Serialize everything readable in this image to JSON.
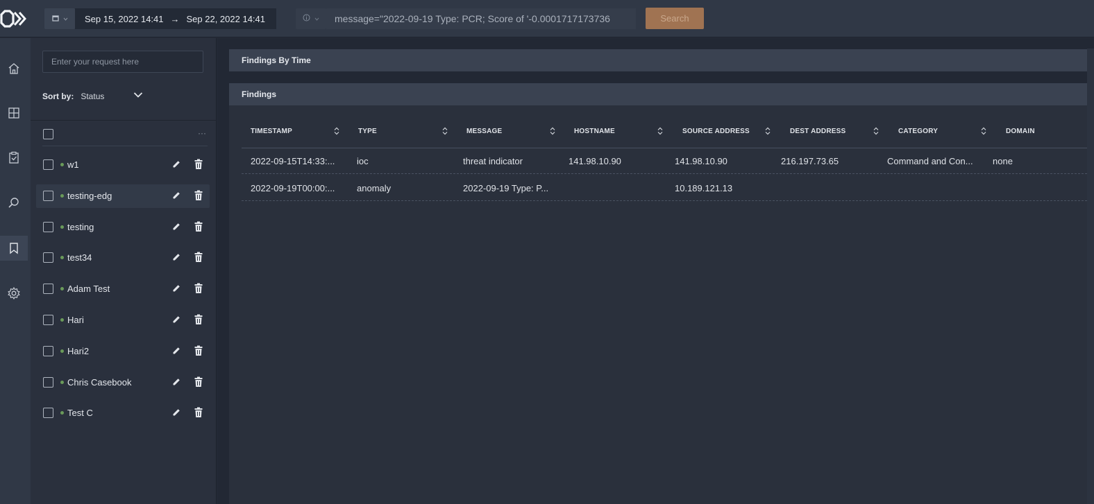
{
  "topbar": {
    "date_start": "Sep 15, 2022 14:41",
    "date_arrow": "→",
    "date_end": "Sep 22, 2022 14:41",
    "query_value": "message=\"2022-09-19 Type: PCR; Score of '-0.0001717173736",
    "search_label": "Search"
  },
  "nav": {
    "items": [
      "home",
      "dashboards",
      "casebooks-checklist",
      "search",
      "bookmarks",
      "settings"
    ],
    "active": "bookmarks"
  },
  "sidebar": {
    "search_placeholder": "Enter your request here",
    "sort_label": "Sort by:",
    "sort_value": "Status",
    "more_label": "···",
    "cases": [
      {
        "name": "w1"
      },
      {
        "name": "testing-edg"
      },
      {
        "name": "testing"
      },
      {
        "name": "test34"
      },
      {
        "name": "Adam Test"
      },
      {
        "name": "Hari"
      },
      {
        "name": "Hari2"
      },
      {
        "name": "Chris Casebook"
      },
      {
        "name": "Test C"
      }
    ]
  },
  "main": {
    "findings_by_time_title": "Findings By Time",
    "findings_title": "Findings",
    "columns": [
      "TIMESTAMP",
      "TYPE",
      "MESSAGE",
      "HOSTNAME",
      "SOURCE ADDRESS",
      "DEST ADDRESS",
      "CATEGORY",
      "DOMAIN"
    ],
    "rows": [
      {
        "timestamp": "2022-09-15T14:33:...",
        "type": "ioc",
        "message": "threat indicator",
        "hostname": "141.98.10.90",
        "source_address": "141.98.10.90",
        "dest_address": "216.197.73.65",
        "category": "Command and Con...",
        "domain": "none"
      },
      {
        "timestamp": "2022-09-19T00:00:...",
        "type": "anomaly",
        "message": "2022-09-19 Type: P...",
        "hostname": "",
        "source_address": "10.189.121.13",
        "dest_address": "",
        "category": "",
        "domain": ""
      }
    ]
  },
  "colors": {
    "accent_search": "#a07352",
    "status_dot": "#6a9a5a",
    "background": "#252b38"
  }
}
